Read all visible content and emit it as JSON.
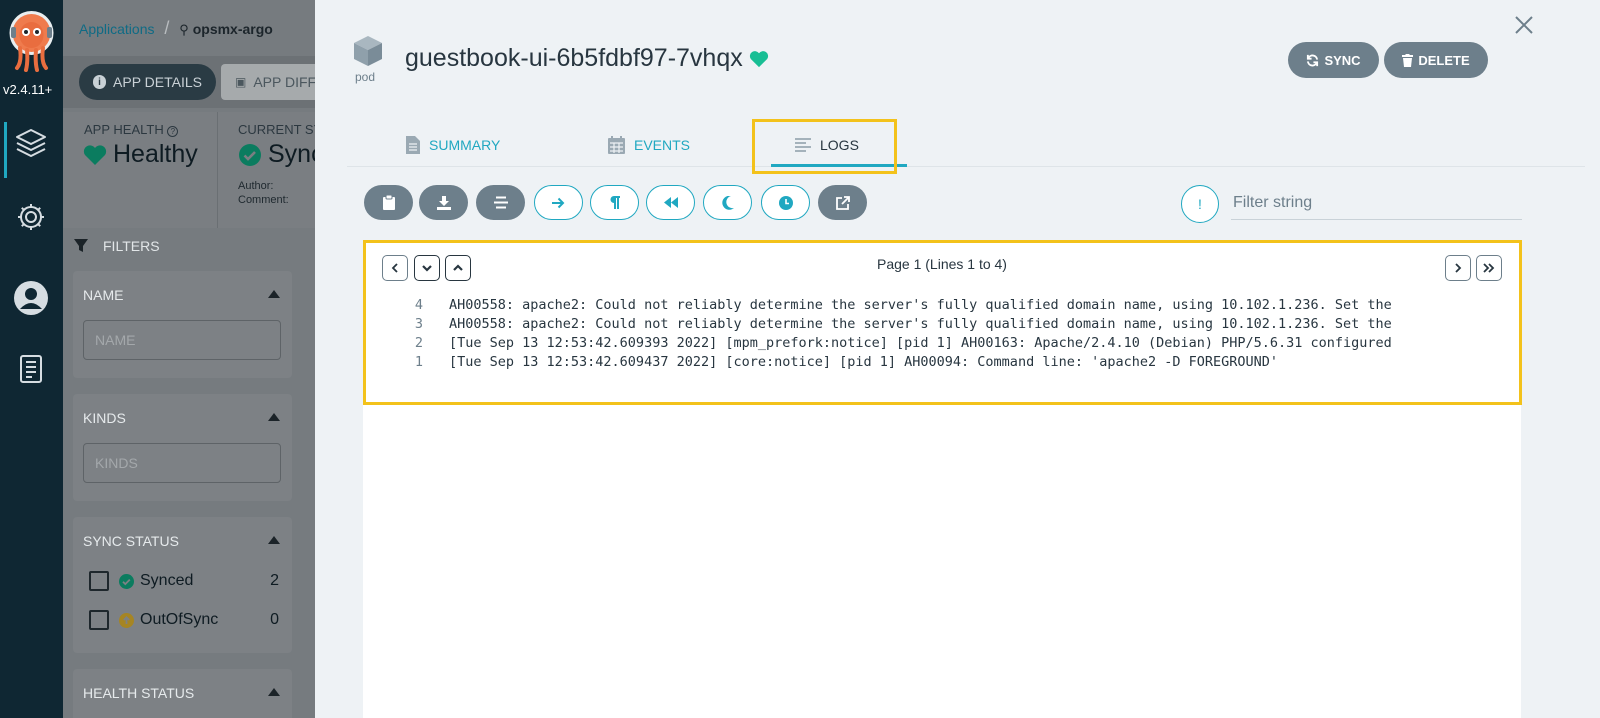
{
  "nav": {
    "version": "v2.4.11+",
    "items": [
      {
        "name": "applications",
        "icon": "layers-icon",
        "active": true
      },
      {
        "name": "settings",
        "icon": "gear-icon"
      },
      {
        "name": "user-info",
        "icon": "user-circle-icon"
      },
      {
        "name": "documentation",
        "icon": "book-icon"
      }
    ]
  },
  "breadcrumb": {
    "link": "Applications",
    "current": "opsmx-argo"
  },
  "app_toolbar": {
    "app_details": "APP DETAILS",
    "app_diff": "APP DIFF"
  },
  "app_status": {
    "health_label": "APP HEALTH",
    "health_value": "Healthy",
    "sync_label": "CURRENT SY",
    "sync_value": "Sync",
    "author_label": "Author:",
    "comment_label": "Comment:"
  },
  "filters": {
    "title": "FILTERS",
    "name": {
      "title": "NAME",
      "placeholder": "NAME"
    },
    "kinds": {
      "title": "KINDS",
      "placeholder": "KINDS"
    },
    "sync_status": {
      "title": "SYNC STATUS",
      "options": [
        {
          "label": "Synced",
          "count": "2",
          "color": "#18be94"
        },
        {
          "label": "OutOfSync",
          "count": "0",
          "color": "#f4c030"
        }
      ]
    },
    "health_status": {
      "title": "HEALTH STATUS"
    }
  },
  "panel": {
    "kind_label": "pod",
    "resource_name": "guestbook-ui-6b5fdbf97-7vhqx",
    "health_color": "#18be94",
    "sync_button": "SYNC",
    "delete_button": "DELETE",
    "tabs": [
      {
        "label": "SUMMARY",
        "icon": "file-icon"
      },
      {
        "label": "EVENTS",
        "icon": "calendar-icon"
      },
      {
        "label": "LOGS",
        "icon": "lines-icon",
        "active": true
      }
    ]
  },
  "log_toolbar": {
    "buttons": [
      {
        "name": "copy-logs",
        "icon": "clipboard-icon",
        "style": "solid"
      },
      {
        "name": "download-logs",
        "icon": "download-icon",
        "style": "solid"
      },
      {
        "name": "follow",
        "icon": "align-icon",
        "style": "solid"
      },
      {
        "name": "wrap-lines",
        "icon": "arrow-right-icon",
        "style": "outline"
      },
      {
        "name": "show-line-breaks",
        "icon": "pilcrow-icon",
        "style": "outline"
      },
      {
        "name": "show-previous",
        "icon": "rewind-icon",
        "style": "outline"
      },
      {
        "name": "dark-mode",
        "icon": "moon-icon",
        "style": "outline"
      },
      {
        "name": "show-timestamps",
        "icon": "clock-icon",
        "style": "outline"
      },
      {
        "name": "open-in-new-window",
        "icon": "external-link-icon",
        "style": "solid"
      }
    ],
    "filter_placeholder": "Filter string"
  },
  "log_viewer": {
    "page_info": "Page 1 (Lines 1 to 4)",
    "lines": [
      {
        "num": "4",
        "text": "AH00558: apache2: Could not reliably determine the server's fully qualified domain name, using 10.102.1.236. Set the"
      },
      {
        "num": "3",
        "text": "AH00558: apache2: Could not reliably determine the server's fully qualified domain name, using 10.102.1.236. Set the"
      },
      {
        "num": "2",
        "text": "[Tue Sep 13 12:53:42.609393 2022] [mpm_prefork:notice] [pid 1] AH00163: Apache/2.4.10 (Debian) PHP/5.6.31 configured"
      },
      {
        "num": "1",
        "text": "[Tue Sep 13 12:53:42.609437 2022] [core:notice] [pid 1] AH00094: Command line: 'apache2 -D FOREGROUND'"
      }
    ]
  },
  "highlight_color": "#f3c21b"
}
